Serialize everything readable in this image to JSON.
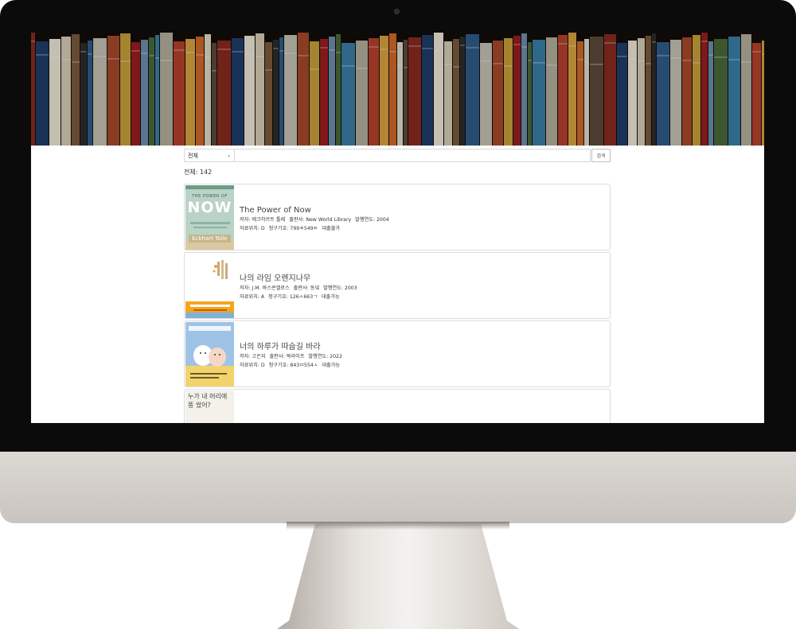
{
  "search": {
    "category": "전체",
    "button_label": "검색"
  },
  "total_label": "전체: 142",
  "books": [
    {
      "title": "The Power of Now",
      "author": "저자: 에크하르트 톨레",
      "publisher": "출판사: New World Library",
      "year": "발행연도: 2004",
      "location": "자료위치: D",
      "call_number": "청구기호: 799ㅍ549ㅌ",
      "status": "대출불가",
      "cover_title_top": "THE POWER OF",
      "cover_title_main": "NOW",
      "cover_author": "Eckhart Tolle"
    },
    {
      "title": "나의 라임 오렌지나무",
      "author": "저자: J.M. 바스콘셀로스",
      "publisher": "출판사: 동녘",
      "year": "발행연도: 2003",
      "location": "자료위치: A",
      "call_number": "청구기호: 126ㅅ663ㄱ",
      "status": "대출가능"
    },
    {
      "title": "너의 하루가 따숩길 바라",
      "author": "저자: 고은지",
      "publisher": "출판사: 북라이프",
      "year": "발행연도: 2022",
      "location": "자료위치: D",
      "call_number": "청구기호: 843ㅁ554ㅅ",
      "status": "대출가능"
    },
    {
      "cover_text_top": "누가 내 머리에",
      "cover_text_bottom": "똥 쌌어?"
    }
  ],
  "colors": {
    "bezel": "#0b0b0b",
    "chin": "#d4cfca",
    "border": "#dcdcdc",
    "banner_bg": "#120d0a"
  }
}
